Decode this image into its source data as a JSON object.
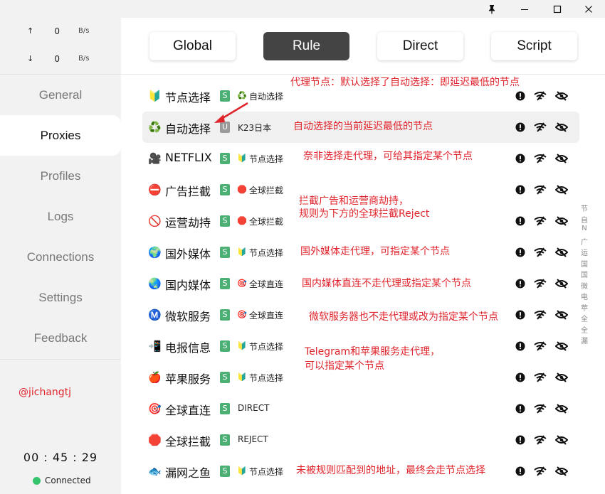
{
  "titlebar": {
    "pin": "pin-icon",
    "minimize": "minimize-icon",
    "maximize": "maximize-icon",
    "close": "close-icon"
  },
  "traffic": {
    "up": {
      "arrow": "↑",
      "value": "0",
      "unit": "B/s"
    },
    "down": {
      "arrow": "↓",
      "value": "0",
      "unit": "B/s"
    }
  },
  "nav": [
    {
      "label": "General"
    },
    {
      "label": "Proxies"
    },
    {
      "label": "Profiles"
    },
    {
      "label": "Logs"
    },
    {
      "label": "Connections"
    },
    {
      "label": "Settings"
    },
    {
      "label": "Feedback"
    }
  ],
  "user": "@jichangtj",
  "clock": "00 : 45 : 29",
  "status": "Connected",
  "status_color": "#36c36e",
  "modes": [
    "Global",
    "Rule",
    "Direct",
    "Script"
  ],
  "active_mode": "Rule",
  "rules": [
    {
      "icon": "🔰",
      "name": "节点选择",
      "badge": "S",
      "sub_icon": "♻️",
      "sub": "自动选择"
    },
    {
      "icon": "♻️",
      "name": "自动选择",
      "badge": "U",
      "sub_icon": "",
      "sub": "K23日本"
    },
    {
      "icon": "🎥",
      "name": "NETFLIX",
      "badge": "S",
      "sub_icon": "🔰",
      "sub": "节点选择"
    },
    {
      "icon": "⛔",
      "name": "广告拦截",
      "badge": "S",
      "sub_icon": "🛑",
      "sub": "全球拦截"
    },
    {
      "icon": "🚫",
      "name": "运营劫持",
      "badge": "S",
      "sub_icon": "🛑",
      "sub": "全球拦截"
    },
    {
      "icon": "🌍",
      "name": "国外媒体",
      "badge": "S",
      "sub_icon": "🔰",
      "sub": "节点选择"
    },
    {
      "icon": "🌏",
      "name": "国内媒体",
      "badge": "S",
      "sub_icon": "🎯",
      "sub": "全球直连"
    },
    {
      "icon": "Ⓜ️",
      "name": "微软服务",
      "badge": "S",
      "sub_icon": "🎯",
      "sub": "全球直连"
    },
    {
      "icon": "📲",
      "name": "电报信息",
      "badge": "S",
      "sub_icon": "🔰",
      "sub": "节点选择"
    },
    {
      "icon": "🍎",
      "name": "苹果服务",
      "badge": "S",
      "sub_icon": "🔰",
      "sub": "节点选择"
    },
    {
      "icon": "🎯",
      "name": "全球直连",
      "badge": "S",
      "sub_icon": "",
      "sub": "DIRECT"
    },
    {
      "icon": "🛑",
      "name": "全球拦截",
      "badge": "S",
      "sub_icon": "",
      "sub": "REJECT"
    },
    {
      "icon": "🐟",
      "name": "漏网之鱼",
      "badge": "S",
      "sub_icon": "🔰",
      "sub": "节点选择"
    }
  ],
  "annotations": [
    "代理节点：默认选择了自动选择：即延迟最低的节点",
    "自动选择的当前延迟最低的节点",
    "奈非选择走代理，可给其指定某个节点",
    "拦截广告和运营商劫持，",
    "规则为下方的全球拦截Reject",
    "国外媒体走代理，可指定某个节点",
    "国内媒体直连不走代理或指定某个节点",
    "微软服务器也不走代理或改为指定某个节点",
    "Telegram和苹果服务走代理，",
    "可以指定某个节点",
    "未被规则匹配到的地址，最终会走节点选择"
  ],
  "annotation_color": "#e0242c",
  "scroll_index": [
    "节",
    "自",
    "N",
    "广",
    "运",
    "国",
    "国",
    "微",
    "电",
    "苹",
    "全",
    "全",
    "漏"
  ],
  "row_actions": [
    "exclamation-icon",
    "wifi-icon",
    "eye-off-icon"
  ]
}
